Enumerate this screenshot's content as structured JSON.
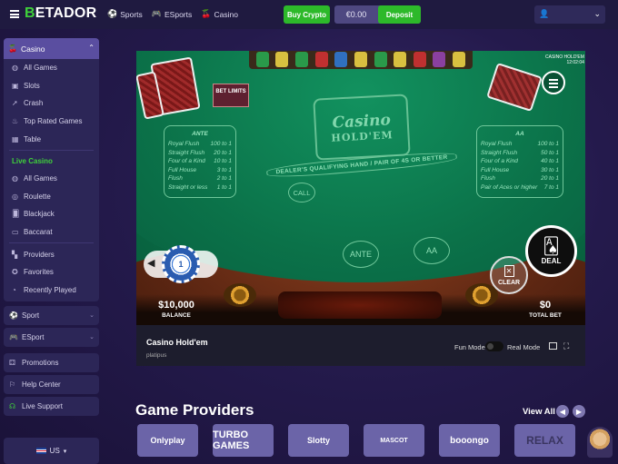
{
  "header": {
    "logo": "ETADOR",
    "nav": [
      {
        "label": "Sports",
        "icon": "soccer-ball-icon"
      },
      {
        "label": "ESports",
        "icon": "gamepad-icon"
      },
      {
        "label": "Casino",
        "icon": "cherries-icon"
      }
    ],
    "buy_crypto": "Buy Crypto",
    "balance": "€0.00",
    "deposit": "Deposit"
  },
  "sidebar": {
    "casino_label": "Casino",
    "casino_items": [
      {
        "label": "All Games",
        "icon": "globe-icon"
      },
      {
        "label": "Slots",
        "icon": "slots-icon"
      },
      {
        "label": "Crash",
        "icon": "rocket-icon"
      },
      {
        "label": "Top Rated Games",
        "icon": "flame-icon"
      },
      {
        "label": "Table",
        "icon": "table-icon"
      }
    ],
    "live_casino_label": "Live Casino",
    "live_items": [
      {
        "label": "All Games",
        "icon": "globe-icon"
      },
      {
        "label": "Roulette",
        "icon": "roulette-icon"
      },
      {
        "label": "Blackjack",
        "icon": "cards-icon"
      },
      {
        "label": "Baccarat",
        "icon": "baccarat-icon"
      }
    ],
    "extra_items": [
      {
        "label": "Providers",
        "icon": "grid-icon"
      },
      {
        "label": "Favorites",
        "icon": "star-icon"
      },
      {
        "label": "Recently Played",
        "icon": "clock-icon"
      }
    ],
    "sport": "Sport",
    "esport": "ESport",
    "promotions": "Promotions",
    "help_center": "Help Center",
    "live_support": "Live Support",
    "language": "US"
  },
  "game": {
    "title": "Casino Hold'em",
    "provider": "platipus",
    "fun_mode": "Fun Mode",
    "real_mode": "Real Mode",
    "table": {
      "logo_line1": "Casino",
      "logo_line2": "HOLD'EM",
      "qualifying_text": "DEALER'S QUALIFYING HAND / PAIR OF 4S OR BETTER",
      "corner_title": "CASINO HOLD'EM",
      "corner_time": "12:02:04",
      "bet_limits": "BET LIMITS",
      "ante_table": {
        "header": "ANTE",
        "rows": [
          [
            "Royal Flush",
            "100 to 1"
          ],
          [
            "Straight Flush",
            "20 to 1"
          ],
          [
            "Four of a Kind",
            "10 to 1"
          ],
          [
            "Full House",
            "3 to 1"
          ],
          [
            "Flush",
            "2 to 1"
          ],
          [
            "Straight or less",
            "1 to 1"
          ]
        ]
      },
      "aa_table": {
        "header": "AA",
        "rows": [
          [
            "Royal Flush",
            "100 to 1"
          ],
          [
            "Straight Flush",
            "50 to 1"
          ],
          [
            "Four of a Kind",
            "40 to 1"
          ],
          [
            "Full House",
            "30 to 1"
          ],
          [
            "Flush",
            "20 to 1"
          ],
          [
            "Pair of Aces or higher",
            "7 to 1"
          ]
        ]
      },
      "call": "CALL",
      "ante": "ANTE",
      "aa": "AA",
      "chip_value": "1",
      "deal": "DEAL",
      "clear": "CLEAR",
      "balance_amount": "$10,000",
      "balance_label": "BALANCE",
      "total_bet_amount": "$0",
      "total_bet_label": "TOTAL BET"
    }
  },
  "providers": {
    "title": "Game Providers",
    "view_all": "View All",
    "items": [
      "Onlyplay",
      "TURBO GAMES",
      "Slotty",
      "MASCOT",
      "booongo",
      "RELAX"
    ]
  }
}
